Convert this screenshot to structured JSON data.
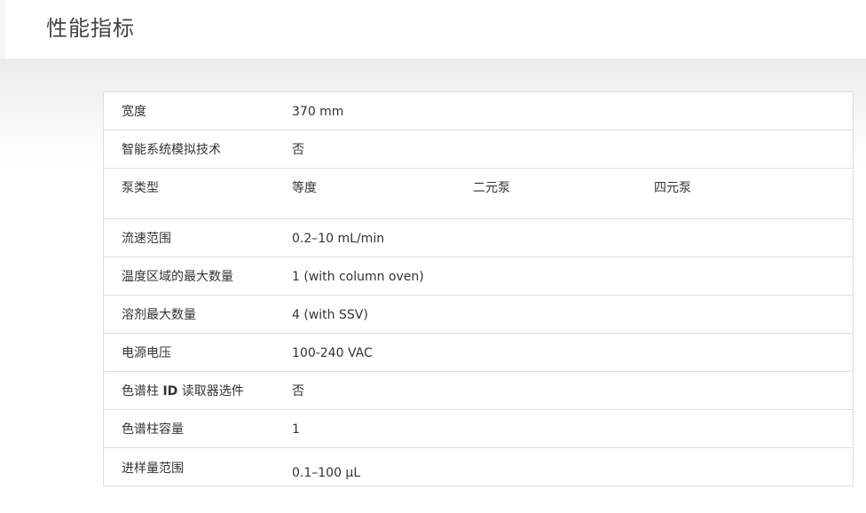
{
  "page": {
    "title": "性能指标"
  },
  "specs": [
    {
      "label": "宽度",
      "value": "370 mm"
    },
    {
      "label": "智能系统模拟技术",
      "value": "否"
    },
    {
      "label": "泵类型",
      "values": [
        "等度",
        "二元泵",
        "四元泵"
      ]
    },
    {
      "label": "流速范围",
      "value": "0.2–10 mL/min"
    },
    {
      "label": "温度区域的最大数量",
      "value": "1 (with column oven)"
    },
    {
      "label": "溶剂最大数量",
      "value": "4 (with SSV)"
    },
    {
      "label": "电源电压",
      "value": "100-240 VAC"
    },
    {
      "label_parts": [
        "色谱柱 ",
        "ID",
        " 读取器选件"
      ],
      "value": "否"
    },
    {
      "label": "色谱柱容量",
      "value": "1"
    },
    {
      "label": "进样量范围",
      "value": "0.1–100 µL"
    }
  ]
}
